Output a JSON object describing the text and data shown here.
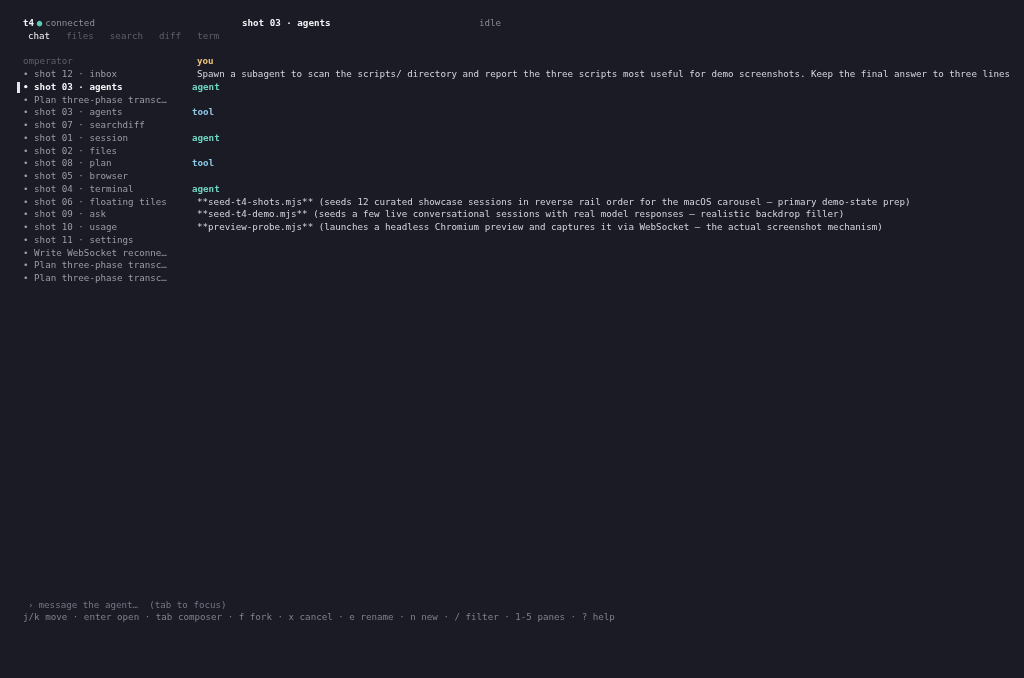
{
  "header": {
    "app": "t4",
    "dot": "●",
    "status": "connected",
    "connected": true,
    "title": "shot 03 · agents",
    "state": "idle"
  },
  "tabs": [
    {
      "label": "chat",
      "selected": true
    },
    {
      "label": "files",
      "selected": false
    },
    {
      "label": "search",
      "selected": false
    },
    {
      "label": "diff",
      "selected": false
    },
    {
      "label": "term",
      "selected": false
    }
  ],
  "sidebar": {
    "heading": "omperator",
    "items": [
      {
        "label": "• shot 12 · inbox",
        "selected": false
      },
      {
        "label": "• shot 03 · agents",
        "selected": true
      },
      {
        "label": "• Plan three-phase transc…",
        "selected": false
      },
      {
        "label": "• shot 03 · agents",
        "selected": false
      },
      {
        "label": "• shot 07 · searchdiff",
        "selected": false
      },
      {
        "label": "• shot 01 · session",
        "selected": false
      },
      {
        "label": "• shot 02 · files",
        "selected": false
      },
      {
        "label": "• shot 08 · plan",
        "selected": false
      },
      {
        "label": "• shot 05 · browser",
        "selected": false
      },
      {
        "label": "• shot 04 · terminal",
        "selected": false
      },
      {
        "label": "• shot 06 · floating tiles",
        "selected": false
      },
      {
        "label": "• shot 09 · ask",
        "selected": false
      },
      {
        "label": "• shot 10 · usage",
        "selected": false
      },
      {
        "label": "• shot 11 · settings",
        "selected": false
      },
      {
        "label": "• Write WebSocket reconne…",
        "selected": false
      },
      {
        "label": "• Plan three-phase transc…",
        "selected": false
      },
      {
        "label": "• Plan three-phase transc…",
        "selected": false
      }
    ]
  },
  "messages": [
    {
      "kind": "user",
      "role": "you",
      "lines": [
        "Spawn a subagent to scan the scripts/ directory and report the three scripts most useful for demo screenshots. Keep the final answer to three lines"
      ]
    },
    {
      "kind": "agent",
      "role": "agent"
    },
    {
      "kind": "tool",
      "role": "tool"
    },
    {
      "kind": "agent",
      "role": "agent"
    },
    {
      "kind": "tool",
      "role": "tool"
    },
    {
      "kind": "agent",
      "role": "agent",
      "lines": [
        "**seed-t4-shots.mjs** (seeds 12 curated showcase sessions in reverse rail order for the macOS carousel — primary demo-state prep)",
        "**seed-t4-demo.mjs** (seeds a few live conversational sessions with real model responses — realistic backdrop filler)",
        "**preview-probe.mjs** (launches a headless Chromium preview and captures it via WebSocket — the actual screenshot mechanism)"
      ]
    }
  ],
  "composer": {
    "prompt": "›",
    "placeholder": "message the agent…  (tab to focus)"
  },
  "hints": "j/k move · enter open · tab composer · f fork · x cancel · e rename · n new · / filter · 1-5 panes · ? help"
}
